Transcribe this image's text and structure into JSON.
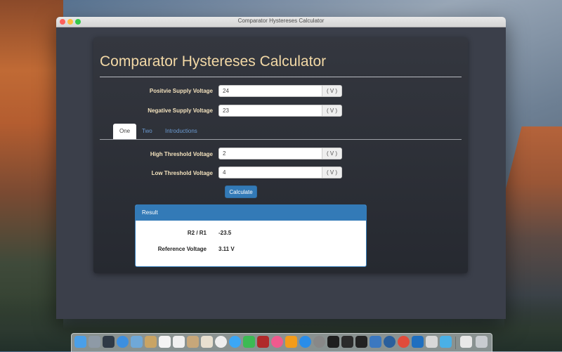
{
  "window": {
    "title": "Comparator Hystereses Calculator"
  },
  "app": {
    "title": "Comparator Hystereses Calculator"
  },
  "supply": {
    "positive": {
      "label": "Positvie Supply Voltage",
      "value": "24",
      "unit": "( V )"
    },
    "negative": {
      "label": "Negative Supply Voltage",
      "value": "23",
      "unit": "( V )"
    }
  },
  "tabs": [
    {
      "label": "One",
      "active": true
    },
    {
      "label": "Two",
      "active": false
    },
    {
      "label": "Introductions",
      "active": false
    }
  ],
  "threshold": {
    "high": {
      "label": "High Threshold Voltage",
      "value": "2",
      "unit": "( V )"
    },
    "low": {
      "label": "Low Threshold Voltage",
      "value": "4",
      "unit": "( V )"
    }
  },
  "calculate_label": "Calculate",
  "result": {
    "heading": "Result",
    "rows": [
      {
        "label": "R2 / R1",
        "value": "-23.5"
      },
      {
        "label": "Reference Voltage",
        "value": "3.11 V"
      }
    ]
  },
  "colors": {
    "accent": "#337ab7",
    "title": "#f3d9a6",
    "card": "#2d3038"
  },
  "dock": {
    "icons": [
      "finder-icon",
      "launchpad-icon",
      "mission-control-icon",
      "safari-icon",
      "preview-icon",
      "notes-icon",
      "calendar-icon",
      "reminders-icon",
      "contacts-icon",
      "photos-icon",
      "messages-icon",
      "facetime-icon",
      "photo-booth-icon",
      "itunes-icon",
      "ibooks-icon",
      "app-store-icon",
      "system-preferences-icon",
      "terminal-icon",
      "console-icon",
      "activity-monitor-icon",
      "xcode-icon",
      "network-icon",
      "chrome-icon",
      "vscode-icon",
      "preview-app-icon",
      "downloads-icon",
      "documents-icon",
      "trash-icon"
    ]
  }
}
